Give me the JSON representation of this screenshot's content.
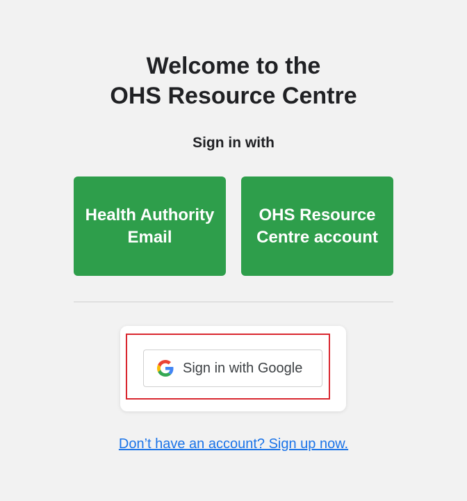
{
  "header": {
    "title_line1": "Welcome to the",
    "title_line2": "OHS Resource Centre",
    "subtitle": "Sign in with"
  },
  "options": {
    "health_authority_label": "Health Authority Email",
    "ohs_account_label": "OHS Resource Centre account"
  },
  "google": {
    "label": "Sign in with Google",
    "icon": "google-g-icon"
  },
  "footer": {
    "signup_link": "Don’t have an account? Sign up now."
  },
  "colors": {
    "background": "#f2f2f2",
    "option_button": "#2e9e4b",
    "highlight_border": "#d9262e",
    "link": "#1a73e8"
  }
}
